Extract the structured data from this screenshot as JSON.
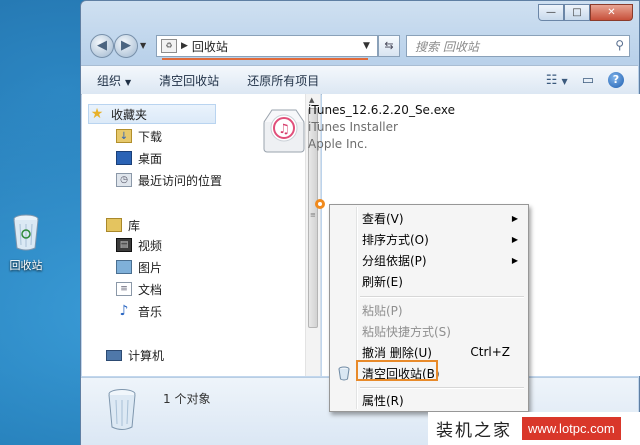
{
  "desktop": {
    "recycle_bin_label": "回收站"
  },
  "window": {
    "controls": [
      "—",
      "□",
      "✕"
    ]
  },
  "address": {
    "path": "回收站",
    "search_placeholder": "搜索 回收站"
  },
  "toolbar": {
    "organize": "组织",
    "empty_bin": "清空回收站",
    "restore_all": "还原所有项目"
  },
  "nav": {
    "favorites": "收藏夹",
    "fav_items": [
      "下载",
      "桌面",
      "最近访问的位置"
    ],
    "libraries": "库",
    "lib_items": [
      "视频",
      "图片",
      "文档",
      "音乐"
    ],
    "computer": "计算机"
  },
  "file": {
    "name": "iTunes_12.6.2.20_Se.exe",
    "description": "iTunes Installer",
    "company": "Apple Inc."
  },
  "status": {
    "count": "1 个对象"
  },
  "context_menu": {
    "items": [
      {
        "label": "查看(V)",
        "submenu": true
      },
      {
        "label": "排序方式(O)",
        "submenu": true
      },
      {
        "label": "分组依据(P)",
        "submenu": true
      },
      {
        "label": "刷新(E)"
      },
      {
        "label": "粘贴(P)",
        "disabled": true
      },
      {
        "label": "粘贴快捷方式(S)",
        "disabled": true
      },
      {
        "label": "撤消 删除(U)",
        "accel": "Ctrl+Z"
      },
      {
        "label": "清空回收站(B)",
        "highlighted": true
      },
      {
        "label": "属性(R)"
      }
    ]
  },
  "watermark": {
    "brand": "装机之家",
    "url": "www.lotpc.com"
  },
  "colors": {
    "highlight": "#e88a2a",
    "watermark_red": "#d9372a"
  }
}
